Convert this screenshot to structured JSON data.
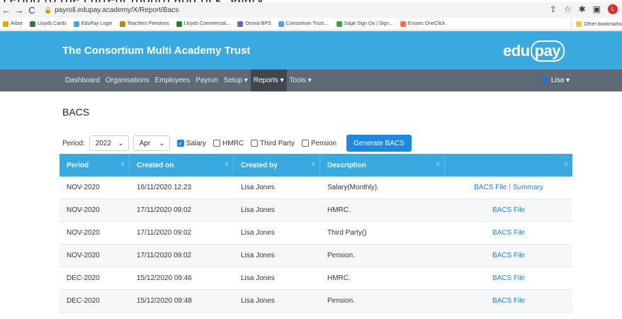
{
  "caption": "Period to the current month and tick Salary",
  "browser": {
    "url": "payroll.edupay.academy/X/Report/Bacs",
    "bookmarks": [
      {
        "label": "Arbor",
        "color": "#e8a317"
      },
      {
        "label": "Lloyds Cards",
        "color": "#2e7d32"
      },
      {
        "label": "EduPay Login",
        "color": "#3aa9df"
      },
      {
        "label": "Teachers Pensions",
        "color": "#b8860b"
      },
      {
        "label": "Lloyds Commercial...",
        "color": "#2e7d32"
      },
      {
        "label": "Orovia BPS",
        "color": "#5c6bc0"
      },
      {
        "label": "Consortium Trust ...",
        "color": "#42a5f5"
      },
      {
        "label": "Sage Sign On | Sign...",
        "color": "#43a047"
      },
      {
        "label": "Eroses OneClick",
        "color": "#ff7043"
      }
    ],
    "other_bookmarks": "Other bookmarks",
    "profile_initial": "L"
  },
  "header": {
    "title": "The Consortium Multi Academy Trust",
    "logo_part1": "edu",
    "logo_part2": "pay"
  },
  "nav": {
    "items": [
      "Dashboard",
      "Organisations",
      "Employees",
      "Payrun",
      "Setup ▾",
      "Reports ▾",
      "Tools ▾"
    ],
    "active_index": 5,
    "user": "Lisa"
  },
  "page": {
    "heading": "BACS"
  },
  "filters": {
    "period_label": "Period:",
    "year": "2022",
    "month": "Apr",
    "checkboxes": [
      {
        "label": "Salary",
        "checked": true
      },
      {
        "label": "HMRC",
        "checked": false
      },
      {
        "label": "Third Party",
        "checked": false
      },
      {
        "label": "Pension",
        "checked": false
      }
    ],
    "generate_button": "Generate BACS"
  },
  "table": {
    "columns": [
      "Period",
      "Created on",
      "Created by",
      "Description",
      ""
    ],
    "rows": [
      {
        "period": "NOV-2020",
        "created_on": "16/11/2020 12:23",
        "created_by": "Lisa Jones",
        "description": "Salary(Monthly).",
        "action1": "BACS File",
        "action2": "Summary"
      },
      {
        "period": "NOV-2020",
        "created_on": "17/11/2020 09:02",
        "created_by": "Lisa Jones",
        "description": "HMRC.",
        "action1": "BACS File",
        "action2": ""
      },
      {
        "period": "NOV-2020",
        "created_on": "17/11/2020 09:02",
        "created_by": "Lisa Jones",
        "description": "Third Party()",
        "action1": "BACS File",
        "action2": ""
      },
      {
        "period": "NOV-2020",
        "created_on": "17/11/2020 09:02",
        "created_by": "Lisa Jones",
        "description": "Pension.",
        "action1": "BACS File",
        "action2": ""
      },
      {
        "period": "DEC-2020",
        "created_on": "15/12/2020 09:46",
        "created_by": "Lisa Jones",
        "description": "HMRC.",
        "action1": "BACS File",
        "action2": ""
      },
      {
        "period": "DEC-2020",
        "created_on": "15/12/2020 09:48",
        "created_by": "Lisa Jones",
        "description": "Pension.",
        "action1": "BACS File",
        "action2": ""
      }
    ]
  }
}
